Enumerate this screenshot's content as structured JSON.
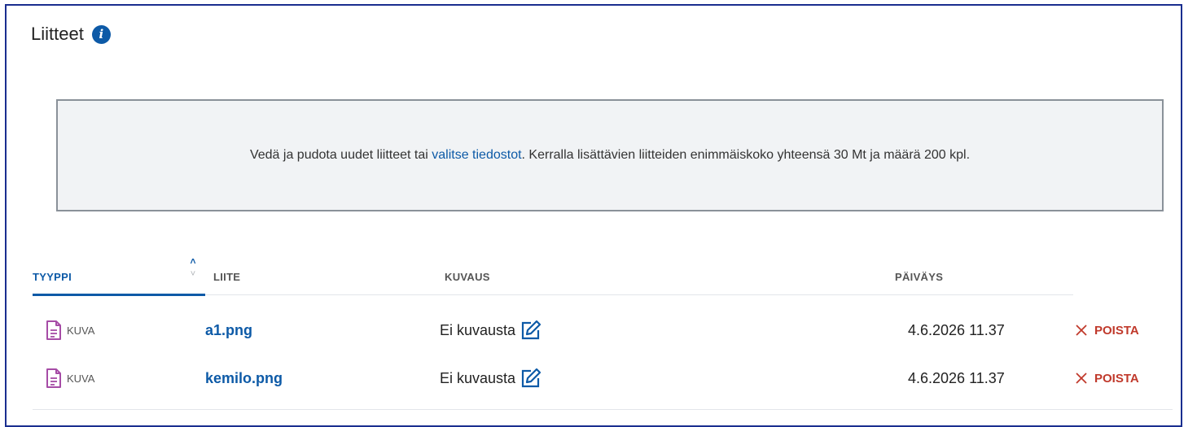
{
  "section": {
    "title": "Liitteet",
    "info_icon": "info-icon"
  },
  "dropzone": {
    "text_before": "Vedä ja pudota uudet liitteet tai ",
    "link_text": "valitse tiedostot",
    "text_after": ". Kerralla lisättävien liitteiden enimmäiskoko yhteensä 30 Mt ja määrä 200 kpl."
  },
  "table": {
    "columns": {
      "type": "TYYPPI",
      "attachment": "LIITE",
      "description": "KUVAUS",
      "date": "PÄIVÄYS"
    },
    "sort": {
      "column": "TYYPPI",
      "direction": "ascending"
    },
    "rows": [
      {
        "type": "KUVA",
        "name": "a1.png",
        "description": "Ei kuvausta",
        "date": "4.6.2026 11.37",
        "remove_label": "POISTA"
      },
      {
        "type": "KUVA",
        "name": "kemilo.png",
        "description": "Ei kuvausta",
        "date": "4.6.2026 11.37",
        "remove_label": "POISTA"
      }
    ]
  },
  "colors": {
    "accent": "#0d5aa7",
    "border": "#1a2e8f",
    "danger": "#c0392b",
    "file_icon": "#a64ca6"
  }
}
